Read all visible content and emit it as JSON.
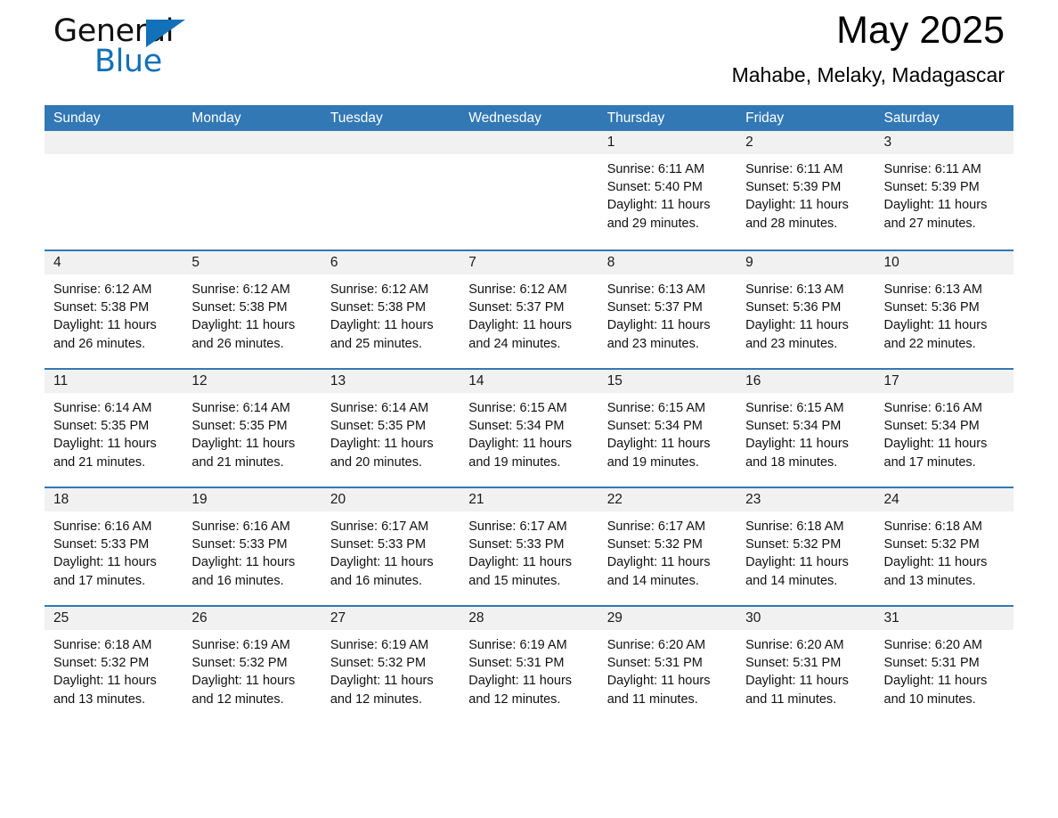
{
  "brand": {
    "name_part1": "General",
    "name_part2": "Blue",
    "triangle_color": "#1271B8"
  },
  "header": {
    "title": "May 2025",
    "subtitle": "Mahabe, Melaky, Madagascar"
  },
  "theme": {
    "header_blue": "#3278B5",
    "day_band_gray": "#F1F1F1",
    "text_black": "#111111"
  },
  "weekdays": [
    "Sunday",
    "Monday",
    "Tuesday",
    "Wednesday",
    "Thursday",
    "Friday",
    "Saturday"
  ],
  "labels": {
    "sunrise_prefix": "Sunrise:",
    "sunset_prefix": "Sunset:",
    "daylight_prefix": "Daylight:"
  },
  "weeks": [
    [
      {
        "day": "",
        "empty": true
      },
      {
        "day": "",
        "empty": true
      },
      {
        "day": "",
        "empty": true
      },
      {
        "day": "",
        "empty": true
      },
      {
        "day": "1",
        "sunrise": "Sunrise: 6:11 AM",
        "sunset": "Sunset: 5:40 PM",
        "daylight": "Daylight: 11 hours and 29 minutes."
      },
      {
        "day": "2",
        "sunrise": "Sunrise: 6:11 AM",
        "sunset": "Sunset: 5:39 PM",
        "daylight": "Daylight: 11 hours and 28 minutes."
      },
      {
        "day": "3",
        "sunrise": "Sunrise: 6:11 AM",
        "sunset": "Sunset: 5:39 PM",
        "daylight": "Daylight: 11 hours and 27 minutes."
      }
    ],
    [
      {
        "day": "4",
        "sunrise": "Sunrise: 6:12 AM",
        "sunset": "Sunset: 5:38 PM",
        "daylight": "Daylight: 11 hours and 26 minutes."
      },
      {
        "day": "5",
        "sunrise": "Sunrise: 6:12 AM",
        "sunset": "Sunset: 5:38 PM",
        "daylight": "Daylight: 11 hours and 26 minutes."
      },
      {
        "day": "6",
        "sunrise": "Sunrise: 6:12 AM",
        "sunset": "Sunset: 5:38 PM",
        "daylight": "Daylight: 11 hours and 25 minutes."
      },
      {
        "day": "7",
        "sunrise": "Sunrise: 6:12 AM",
        "sunset": "Sunset: 5:37 PM",
        "daylight": "Daylight: 11 hours and 24 minutes."
      },
      {
        "day": "8",
        "sunrise": "Sunrise: 6:13 AM",
        "sunset": "Sunset: 5:37 PM",
        "daylight": "Daylight: 11 hours and 23 minutes."
      },
      {
        "day": "9",
        "sunrise": "Sunrise: 6:13 AM",
        "sunset": "Sunset: 5:36 PM",
        "daylight": "Daylight: 11 hours and 23 minutes."
      },
      {
        "day": "10",
        "sunrise": "Sunrise: 6:13 AM",
        "sunset": "Sunset: 5:36 PM",
        "daylight": "Daylight: 11 hours and 22 minutes."
      }
    ],
    [
      {
        "day": "11",
        "sunrise": "Sunrise: 6:14 AM",
        "sunset": "Sunset: 5:35 PM",
        "daylight": "Daylight: 11 hours and 21 minutes."
      },
      {
        "day": "12",
        "sunrise": "Sunrise: 6:14 AM",
        "sunset": "Sunset: 5:35 PM",
        "daylight": "Daylight: 11 hours and 21 minutes."
      },
      {
        "day": "13",
        "sunrise": "Sunrise: 6:14 AM",
        "sunset": "Sunset: 5:35 PM",
        "daylight": "Daylight: 11 hours and 20 minutes."
      },
      {
        "day": "14",
        "sunrise": "Sunrise: 6:15 AM",
        "sunset": "Sunset: 5:34 PM",
        "daylight": "Daylight: 11 hours and 19 minutes."
      },
      {
        "day": "15",
        "sunrise": "Sunrise: 6:15 AM",
        "sunset": "Sunset: 5:34 PM",
        "daylight": "Daylight: 11 hours and 19 minutes."
      },
      {
        "day": "16",
        "sunrise": "Sunrise: 6:15 AM",
        "sunset": "Sunset: 5:34 PM",
        "daylight": "Daylight: 11 hours and 18 minutes."
      },
      {
        "day": "17",
        "sunrise": "Sunrise: 6:16 AM",
        "sunset": "Sunset: 5:34 PM",
        "daylight": "Daylight: 11 hours and 17 minutes."
      }
    ],
    [
      {
        "day": "18",
        "sunrise": "Sunrise: 6:16 AM",
        "sunset": "Sunset: 5:33 PM",
        "daylight": "Daylight: 11 hours and 17 minutes."
      },
      {
        "day": "19",
        "sunrise": "Sunrise: 6:16 AM",
        "sunset": "Sunset: 5:33 PM",
        "daylight": "Daylight: 11 hours and 16 minutes."
      },
      {
        "day": "20",
        "sunrise": "Sunrise: 6:17 AM",
        "sunset": "Sunset: 5:33 PM",
        "daylight": "Daylight: 11 hours and 16 minutes."
      },
      {
        "day": "21",
        "sunrise": "Sunrise: 6:17 AM",
        "sunset": "Sunset: 5:33 PM",
        "daylight": "Daylight: 11 hours and 15 minutes."
      },
      {
        "day": "22",
        "sunrise": "Sunrise: 6:17 AM",
        "sunset": "Sunset: 5:32 PM",
        "daylight": "Daylight: 11 hours and 14 minutes."
      },
      {
        "day": "23",
        "sunrise": "Sunrise: 6:18 AM",
        "sunset": "Sunset: 5:32 PM",
        "daylight": "Daylight: 11 hours and 14 minutes."
      },
      {
        "day": "24",
        "sunrise": "Sunrise: 6:18 AM",
        "sunset": "Sunset: 5:32 PM",
        "daylight": "Daylight: 11 hours and 13 minutes."
      }
    ],
    [
      {
        "day": "25",
        "sunrise": "Sunrise: 6:18 AM",
        "sunset": "Sunset: 5:32 PM",
        "daylight": "Daylight: 11 hours and 13 minutes."
      },
      {
        "day": "26",
        "sunrise": "Sunrise: 6:19 AM",
        "sunset": "Sunset: 5:32 PM",
        "daylight": "Daylight: 11 hours and 12 minutes."
      },
      {
        "day": "27",
        "sunrise": "Sunrise: 6:19 AM",
        "sunset": "Sunset: 5:32 PM",
        "daylight": "Daylight: 11 hours and 12 minutes."
      },
      {
        "day": "28",
        "sunrise": "Sunrise: 6:19 AM",
        "sunset": "Sunset: 5:31 PM",
        "daylight": "Daylight: 11 hours and 12 minutes."
      },
      {
        "day": "29",
        "sunrise": "Sunrise: 6:20 AM",
        "sunset": "Sunset: 5:31 PM",
        "daylight": "Daylight: 11 hours and 11 minutes."
      },
      {
        "day": "30",
        "sunrise": "Sunrise: 6:20 AM",
        "sunset": "Sunset: 5:31 PM",
        "daylight": "Daylight: 11 hours and 11 minutes."
      },
      {
        "day": "31",
        "sunrise": "Sunrise: 6:20 AM",
        "sunset": "Sunset: 5:31 PM",
        "daylight": "Daylight: 11 hours and 10 minutes."
      }
    ]
  ]
}
